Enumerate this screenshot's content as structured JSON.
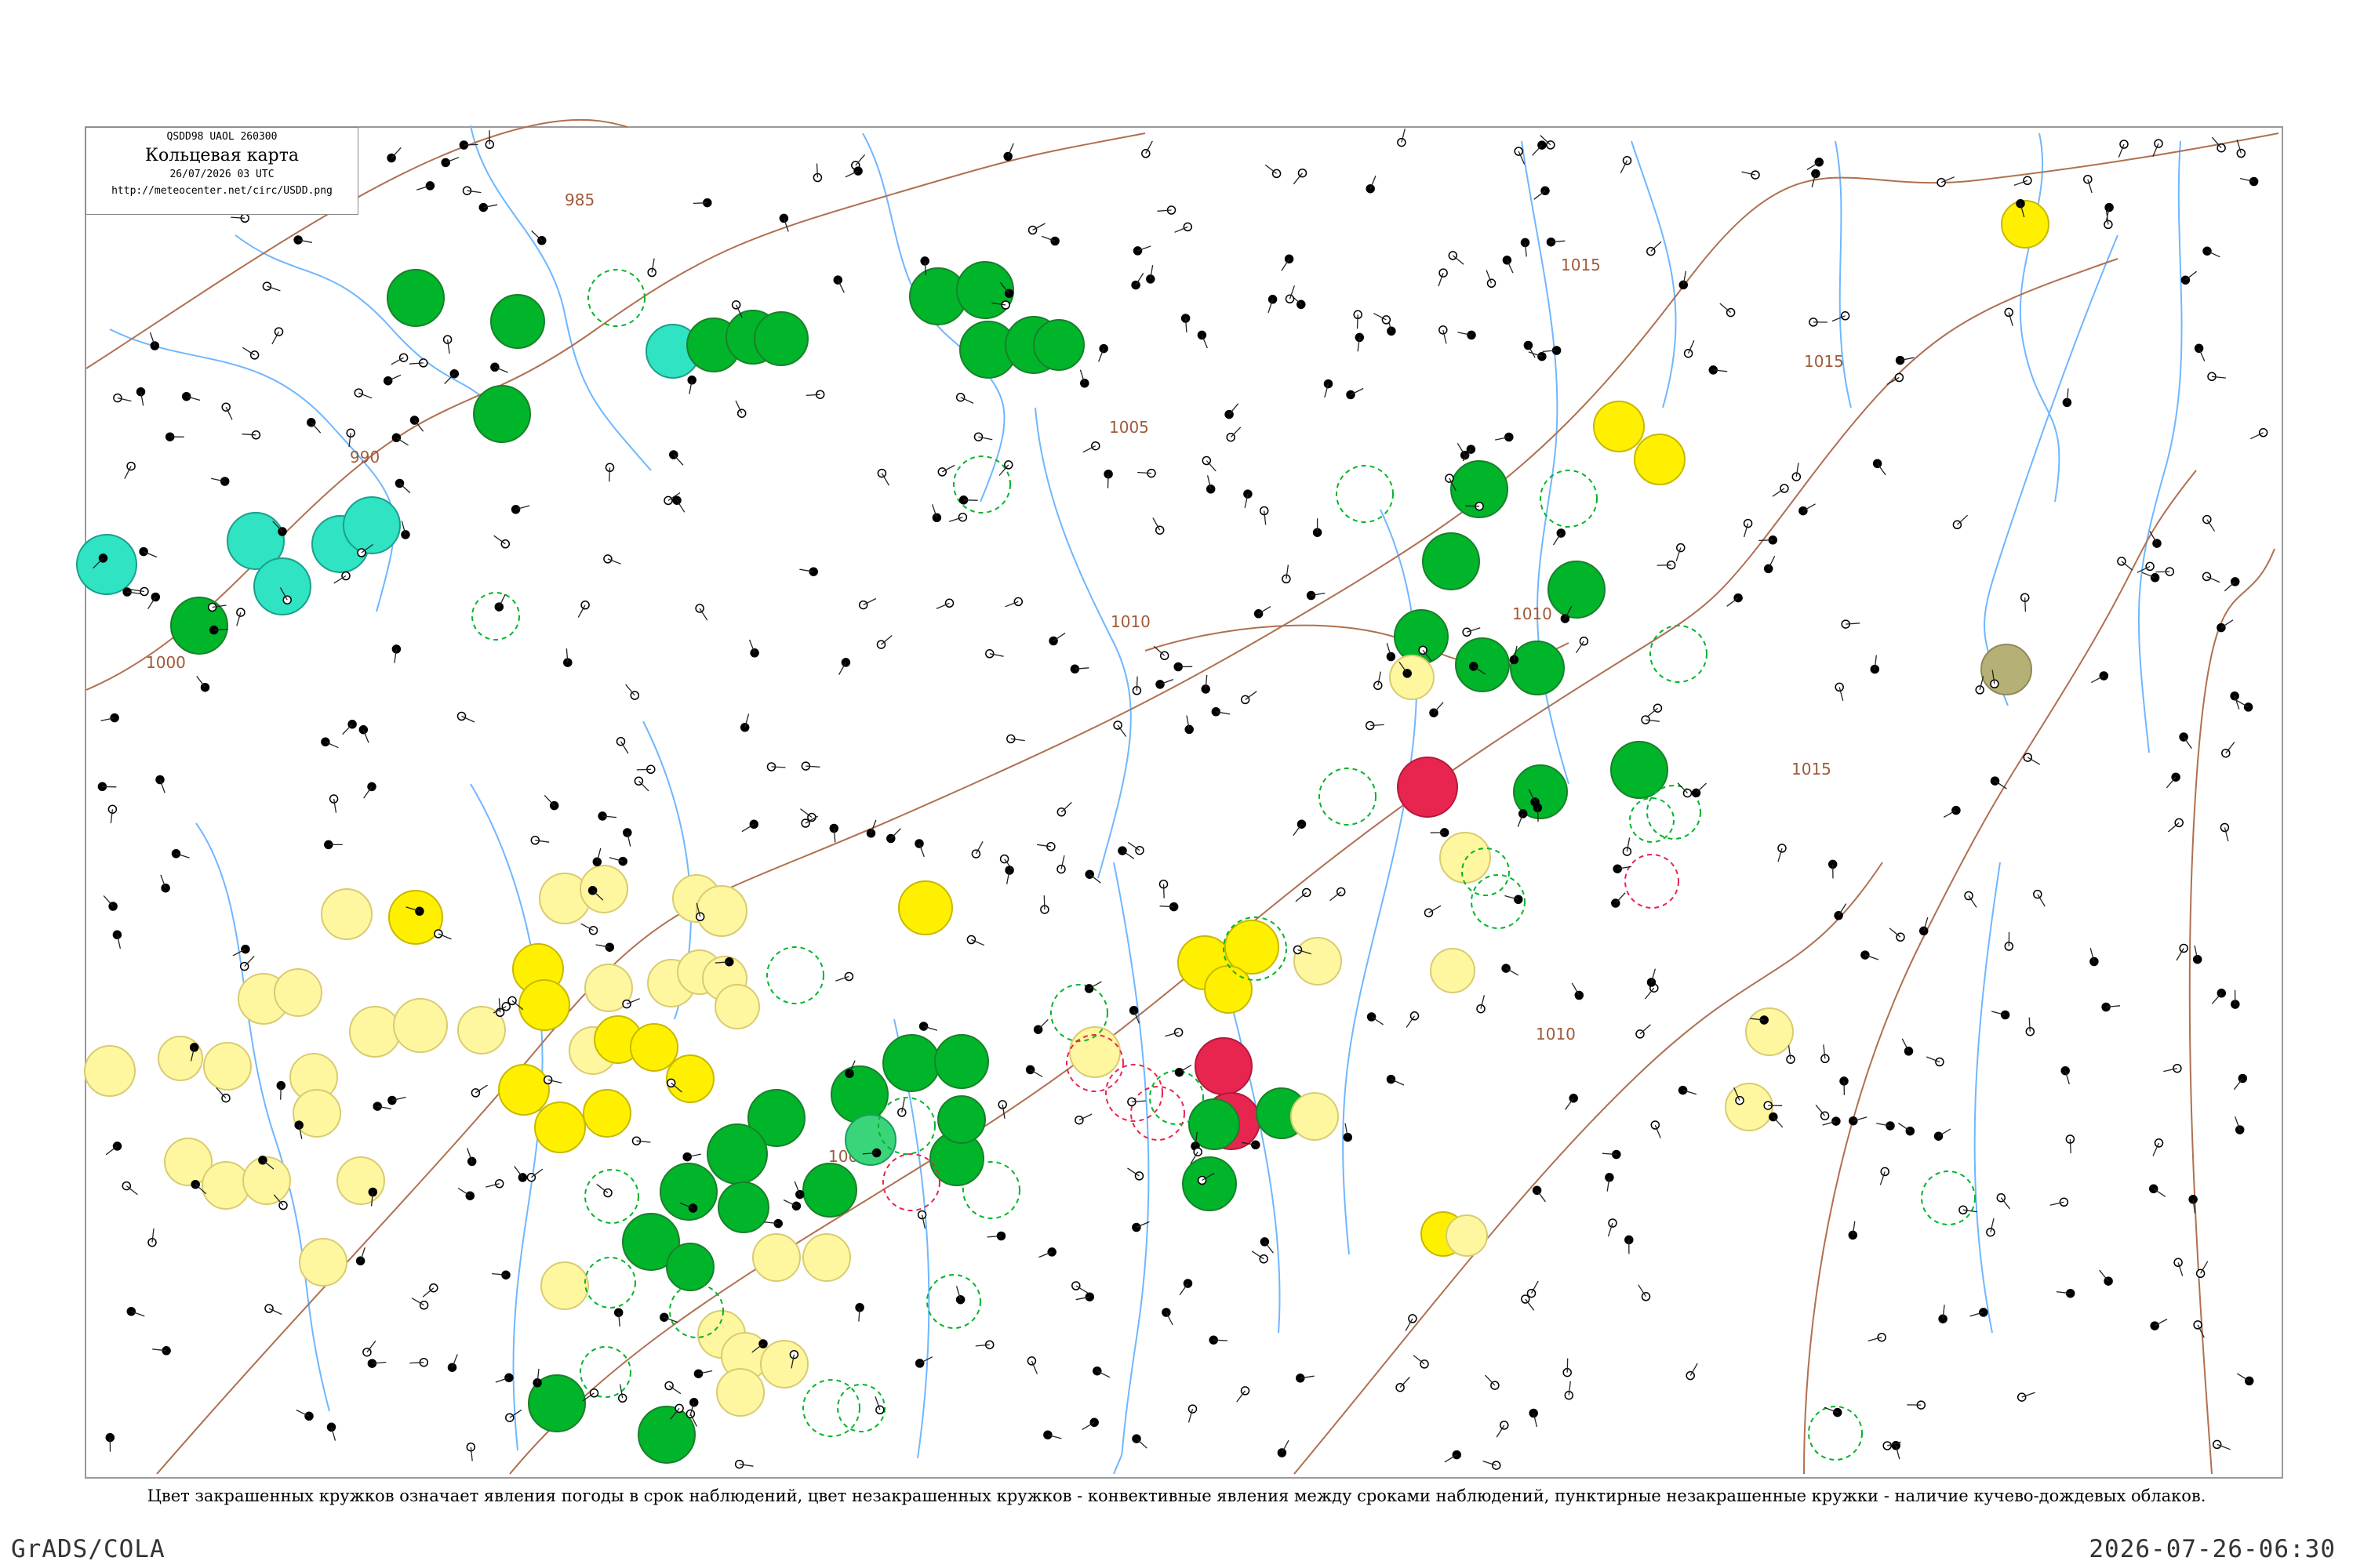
{
  "header": {
    "code": "QSDD98  UAOL  260300",
    "title": "Кольцевая карта",
    "date": "26/07/2026 03 UTC",
    "url": "http://meteocenter.net/circ/USDD.png"
  },
  "isobars": [
    "985",
    "990",
    "1000",
    "1005",
    "1010",
    "1010",
    "1015",
    "1015",
    "1015",
    "1010",
    "1005"
  ],
  "caption": "Цвет закрашенных кружков означает явления погоды в срок наблюдений, цвет незакрашенных кружков - конвективные явления между сроками наблюдений, пунктирные незакрашенные кружки - наличие кучево-дождевых облаков.",
  "footer": {
    "left": "GrADS/COLA",
    "right": "2026-07-26-06:30"
  },
  "colors": {
    "green": "#00b52a",
    "cyan": "#2fe3c3",
    "yellow": "#fff000",
    "pale_yellow": "#fff6a0",
    "red": "#e8254f",
    "olive": "#b5b076",
    "river": "#6fb7ff",
    "isobar": "#b07050",
    "frame": "#999999"
  },
  "stations": [
    {
      "id": "s1",
      "kind": "green",
      "p": "124"
    },
    {
      "id": "s2",
      "kind": "green",
      "p": "116"
    },
    {
      "id": "s3",
      "kind": "green",
      "p": "104"
    },
    {
      "id": "s4",
      "kind": "cyan",
      "p": "135"
    },
    {
      "id": "s5",
      "kind": "green",
      "p": "110"
    },
    {
      "id": "s6",
      "kind": "green",
      "p": "122"
    },
    {
      "id": "s7",
      "kind": "green",
      "p": "138"
    },
    {
      "id": "s8",
      "kind": "green",
      "p": "137"
    },
    {
      "id": "s9",
      "kind": "green",
      "p": "140"
    },
    {
      "id": "s10",
      "kind": "cyan",
      "p": "105"
    },
    {
      "id": "s11",
      "kind": "cyan",
      "p": "131"
    },
    {
      "id": "s12",
      "kind": "cyan",
      "p": "137"
    },
    {
      "id": "s13",
      "kind": "cyan",
      "p": "128"
    },
    {
      "id": "s14",
      "kind": "green",
      "p": "156"
    },
    {
      "id": "s15",
      "kind": "green",
      "p": "116"
    },
    {
      "id": "s16",
      "kind": "yellow",
      "p": "89"
    },
    {
      "id": "s17",
      "kind": "yellow",
      "p": "131"
    },
    {
      "id": "s18",
      "kind": "yellow",
      "p": "171"
    },
    {
      "id": "s19",
      "kind": "yellow",
      "p": "174"
    },
    {
      "id": "s20",
      "kind": "red",
      "p": "187"
    },
    {
      "id": "s21",
      "kind": "red",
      "p": "208"
    },
    {
      "id": "s22",
      "kind": "olive",
      "p": "217"
    },
    {
      "id": "s23",
      "kind": "green",
      "p": "162"
    },
    {
      "id": "s24",
      "kind": "green",
      "p": "198"
    },
    {
      "id": "s25",
      "kind": "pale_yellow",
      "p": "106"
    },
    {
      "id": "s26",
      "kind": "pale_yellow",
      "p": "116"
    },
    {
      "id": "s27",
      "kind": "pale_yellow",
      "p": "120"
    },
    {
      "id": "s28",
      "kind": "green",
      "p": "155"
    },
    {
      "id": "s29",
      "kind": "green",
      "p": "163"
    },
    {
      "id": "s30",
      "kind": "pale_yellow",
      "p": "190"
    }
  ]
}
